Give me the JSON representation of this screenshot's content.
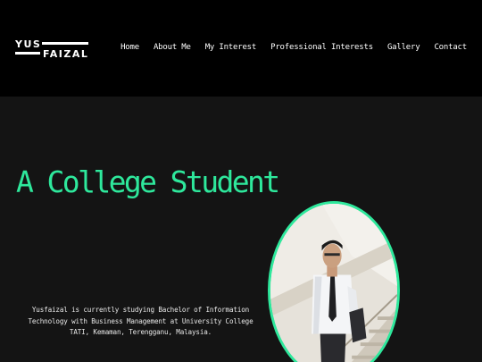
{
  "logo": {
    "line1": "YUS",
    "line2": "FAIZAL"
  },
  "nav": {
    "items": [
      {
        "label": "Home"
      },
      {
        "label": "About Me"
      },
      {
        "label": "My Interest"
      },
      {
        "label": "Professional Interests"
      },
      {
        "label": "Gallery"
      },
      {
        "label": "Contact"
      }
    ]
  },
  "hero": {
    "headline": "A College Student",
    "description": "Yusfaizal is currently studying Bachelor of Information Technology with Business Management at University College TATI, Kemaman, Terengganu, Malaysia."
  },
  "colors": {
    "accent": "#2ee89c",
    "header_bg": "#000000",
    "page_bg": "#141414"
  }
}
